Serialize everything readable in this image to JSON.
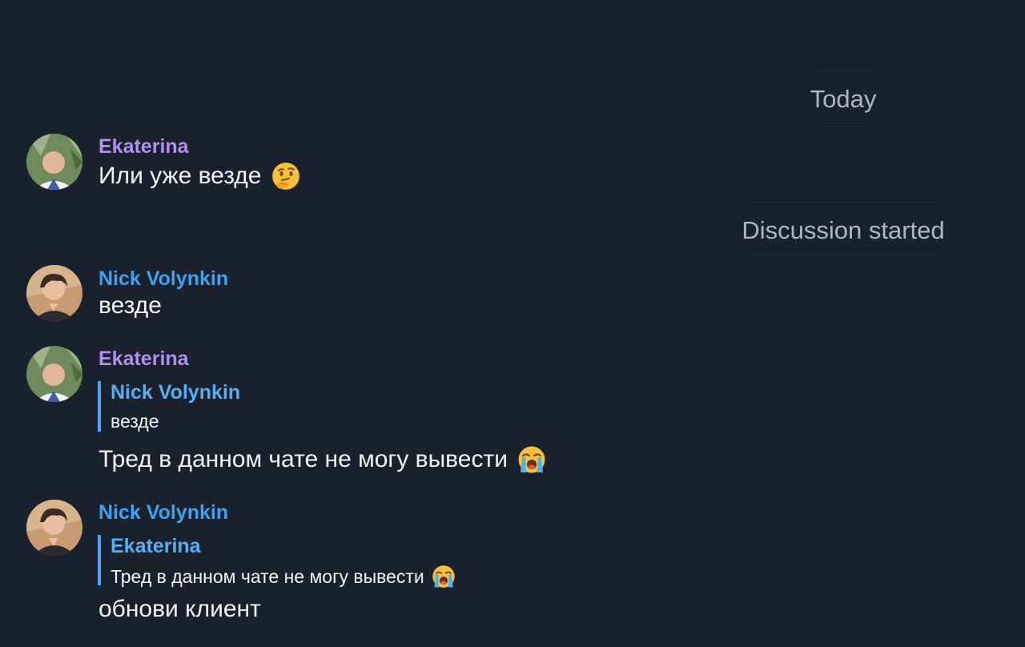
{
  "separators": {
    "today": "Today",
    "discussion": "Discussion started"
  },
  "messages": [
    {
      "sender": "Ekaterina",
      "text": "Или уже везде",
      "emoji": "thinking-face-icon"
    },
    {
      "sender": "Nick Volynkin",
      "text": "везде"
    },
    {
      "sender": "Ekaterina",
      "reply": {
        "sender": "Nick Volynkin",
        "text": "везде"
      },
      "text": "Тред в данном чате не могу вывести",
      "emoji": "loudly-crying-face-icon"
    },
    {
      "sender": "Nick Volynkin",
      "reply": {
        "sender": "Ekaterina",
        "text": "Тред в данном чате не могу вывести",
        "emoji": "loudly-crying-face-icon"
      },
      "text": "обнови клиент"
    }
  ],
  "colors": {
    "background": "#18212c",
    "ekaterina_name": "#b48df0",
    "nick_name": "#3ea2f4",
    "reply_bar": "#4aa8f5",
    "message_text": "#f2f4f7",
    "separator_text": "#aab8c6"
  }
}
